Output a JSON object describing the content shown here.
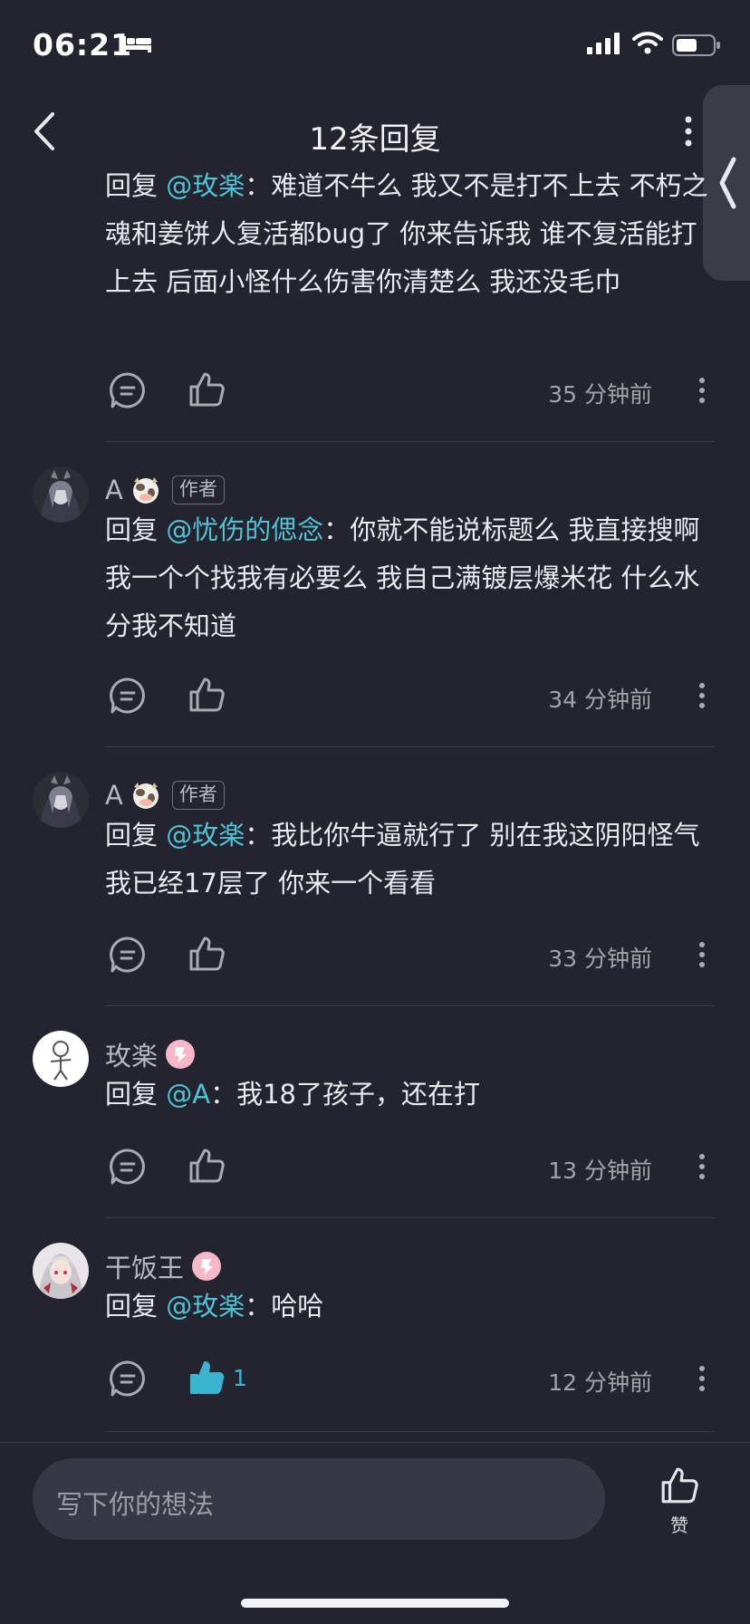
{
  "status_bar": {
    "time": "06:21",
    "icons": [
      "bed-icon",
      "signal-icon",
      "wifi-icon",
      "battery-icon"
    ]
  },
  "nav": {
    "title": "12条回复",
    "back_icon": "chevron-left-icon",
    "more_icon": "more-vertical-icon"
  },
  "side_tab": {
    "icon": "chevron-left-icon"
  },
  "comments": [
    {
      "name": "",
      "reply_prefix": "回复",
      "mention": "@玫楽",
      "text": "：难道不牛么   我又不是打不上去  不朽之魂和姜饼人复活都bug了  你来告诉我  谁不复活能打上去     后面小怪什么伤害你清楚么  我还没毛巾",
      "time": "35 分钟前",
      "like_count": ""
    },
    {
      "name": "A",
      "badge": "作者",
      "reply_prefix": "回复",
      "mention": "@忧伤的偲念",
      "text": "：你就不能说标题么  我直接搜啊  我一个个找我有必要么  我自己满镀层爆米花  什么水分我不知道",
      "time": "34 分钟前",
      "like_count": ""
    },
    {
      "name": "A",
      "badge": "作者",
      "reply_prefix": "回复",
      "mention": "@玫楽",
      "text": "：我比你牛逼就行了  别在我这阴阳怪气  我已经17层了  你来一个看看",
      "time": "33 分钟前",
      "like_count": ""
    },
    {
      "name": "玫楽",
      "reply_prefix": "回复",
      "mention": "@A",
      "text": "：我18了孩子，还在打",
      "time": "13 分钟前",
      "like_count": ""
    },
    {
      "name": "干饭王",
      "reply_prefix": "回复",
      "mention": "@玫楽",
      "text": "：哈哈",
      "time": "12 分钟前",
      "like_count": "1"
    }
  ],
  "bottom_bar": {
    "input_placeholder": "写下你的想法",
    "like_label": "赞"
  },
  "colors": {
    "background": "#23242f",
    "mention": "#51c2d4",
    "liked": "#3bb5cf",
    "badge_pink": "#f6b7c8"
  }
}
